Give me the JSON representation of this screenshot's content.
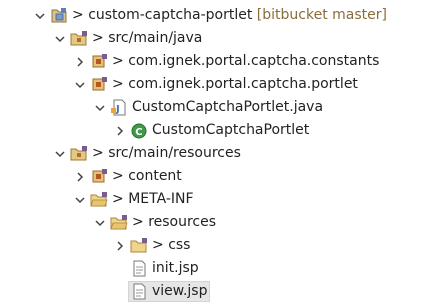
{
  "tree": {
    "rows": [
      {
        "id": "project",
        "prefix": "> ",
        "label": "custom-captcha-portlet",
        "decoration": "[bitbucket master]",
        "expanded": true,
        "icon": "project-icon"
      },
      {
        "id": "src-main-java",
        "prefix": "> ",
        "label": "src/main/java",
        "expanded": true,
        "icon": "source-folder-icon"
      },
      {
        "id": "pkg-constants",
        "prefix": "> ",
        "label": "com.ignek.portal.captcha.constants",
        "expanded": false,
        "icon": "package-icon"
      },
      {
        "id": "pkg-portlet",
        "prefix": "> ",
        "label": "com.ignek.portal.captcha.portlet",
        "expanded": true,
        "icon": "package-icon"
      },
      {
        "id": "java-file",
        "prefix": "",
        "label": "CustomCaptchaPortlet.java",
        "expanded": true,
        "icon": "java-file-icon"
      },
      {
        "id": "java-class",
        "prefix": "",
        "label": "CustomCaptchaPortlet",
        "expanded": false,
        "icon": "class-icon"
      },
      {
        "id": "src-main-resources",
        "prefix": "> ",
        "label": "src/main/resources",
        "expanded": true,
        "icon": "source-folder-icon"
      },
      {
        "id": "content",
        "prefix": "> ",
        "label": "content",
        "expanded": false,
        "icon": "package-icon"
      },
      {
        "id": "meta-inf",
        "prefix": "> ",
        "label": "META-INF",
        "expanded": true,
        "icon": "folder-icon"
      },
      {
        "id": "resources",
        "prefix": "> ",
        "label": "resources",
        "expanded": true,
        "icon": "folder-icon"
      },
      {
        "id": "css",
        "prefix": "> ",
        "label": "css",
        "expanded": false,
        "icon": "folder-icon"
      },
      {
        "id": "init-jsp",
        "prefix": "",
        "label": "init.jsp",
        "expanded": false,
        "icon": "jsp-file-icon"
      },
      {
        "id": "view-jsp",
        "prefix": "",
        "label": "view.jsp",
        "expanded": false,
        "icon": "jsp-file-icon",
        "selected": true
      }
    ]
  }
}
